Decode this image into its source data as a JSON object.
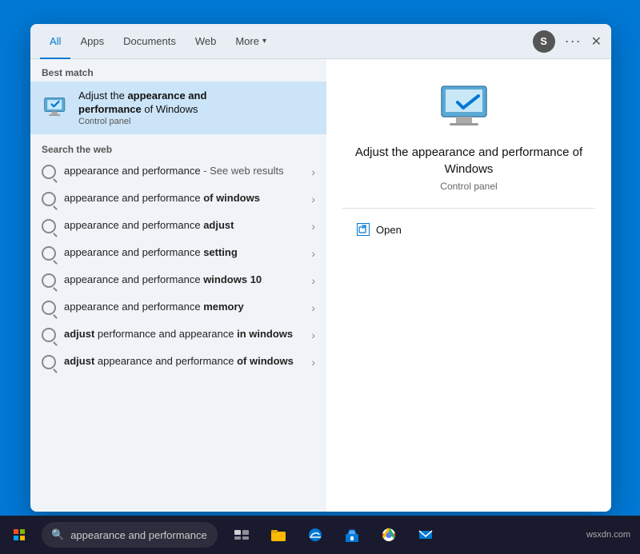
{
  "tabs": {
    "all": "All",
    "apps": "Apps",
    "documents": "Documents",
    "web": "Web",
    "more": "More",
    "active": "all"
  },
  "header": {
    "user_avatar": "S",
    "dots": "···",
    "close": "✕"
  },
  "left": {
    "best_match_label": "Best match",
    "best_match_title_plain": "Adjust the ",
    "best_match_title_bold": "appearance and performance",
    "best_match_title_end": " of Windows",
    "best_match_subtitle": "Control panel",
    "web_label": "Search the web",
    "web_items": [
      {
        "plain": "appearance and performance",
        "bold": "",
        "extra": " - See web results"
      },
      {
        "plain": "appearance and performance ",
        "bold": "of windows",
        "extra": ""
      },
      {
        "plain": "appearance and performance ",
        "bold": "adjust",
        "extra": ""
      },
      {
        "plain": "appearance and performance ",
        "bold": "setting",
        "extra": ""
      },
      {
        "plain": "appearance and performance ",
        "bold": "windows 10",
        "extra": ""
      },
      {
        "plain": "appearance and performance ",
        "bold": "memory",
        "extra": ""
      },
      {
        "plain_1": "adjust",
        "bold_1": " performance and appearance ",
        "plain_2": "in windows",
        "extra": "",
        "type": "bold_first"
      },
      {
        "plain_1": "adjust",
        "bold_1": " appearance and performance ",
        "plain_2": "of windows",
        "extra": "",
        "type": "bold_first"
      }
    ]
  },
  "right": {
    "title_line1": "Adjust the appearance and performance of",
    "title_line2": "Windows",
    "subtitle": "Control panel",
    "open_label": "Open"
  },
  "taskbar": {
    "search_placeholder": "appearance and performance",
    "wsxdn": "wsxdn.com"
  }
}
